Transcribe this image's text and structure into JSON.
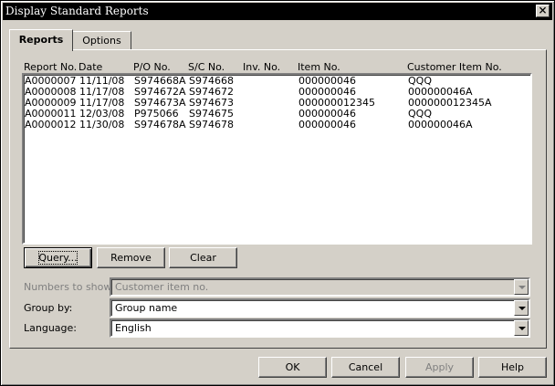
{
  "window": {
    "title": "Display Standard Reports",
    "close_label": "×"
  },
  "tabs": [
    {
      "label": "Reports"
    },
    {
      "label": "Options"
    }
  ],
  "table": {
    "columns": [
      "Report No.",
      "Date",
      "P/O No.",
      "S/C No.",
      "Inv. No.",
      "Item No.",
      "Customer Item No."
    ],
    "rows": [
      [
        "A0000007",
        "11/11/08",
        "S974668A",
        "S974668",
        "",
        "000000046",
        "QQQ"
      ],
      [
        "A0000008",
        "11/17/08",
        "S974672A",
        "S974672",
        "",
        "000000046",
        "000000046A"
      ],
      [
        "A0000009",
        "11/17/08",
        "S974673A",
        "S974673",
        "",
        "000000012345",
        "000000012345A"
      ],
      [
        "A0000011",
        "12/03/08",
        "P975066",
        "S974675",
        "",
        "000000046",
        "QQQ"
      ],
      [
        "A0000012",
        "11/30/08",
        "S974678A",
        "S974678",
        "",
        "000000046",
        "000000046A"
      ]
    ]
  },
  "list_buttons": {
    "query": "Query...",
    "remove": "Remove",
    "clear": "Clear"
  },
  "form": {
    "numbers_to_show": {
      "label": "Numbers to show:",
      "value": "Customer item no."
    },
    "group_by": {
      "label": "Group by:",
      "value": "Group name"
    },
    "language": {
      "label": "Language:",
      "value": "English"
    }
  },
  "footer": {
    "ok": "OK",
    "cancel": "Cancel",
    "apply": "Apply",
    "help": "Help"
  }
}
